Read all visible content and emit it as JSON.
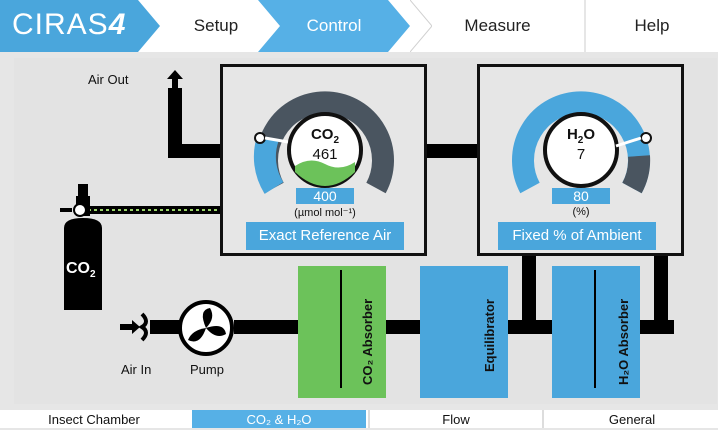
{
  "app": {
    "logo_text": "CIRAS",
    "logo_num": "4"
  },
  "nav": {
    "setup": "Setup",
    "control": "Control",
    "measure": "Measure",
    "help": "Help"
  },
  "co2": {
    "label": "CO",
    "sub": "2",
    "value": "461",
    "setpoint": "400",
    "unit": "(µmol mol⁻¹)",
    "mode": "Exact Reference Air",
    "level_fraction": 0.45
  },
  "h2o": {
    "label": "H",
    "sub_h": "2",
    "label_o": "O",
    "value": "7",
    "setpoint": "80",
    "unit": "(%)",
    "mode": "Fixed % of Ambient",
    "level_fraction": 0.8
  },
  "diagram": {
    "air_out": "Air Out",
    "air_in": "Air In",
    "pump": "Pump",
    "cylinder": "CO",
    "cylinder_sub": "2",
    "co2_absorber": "CO₂ Absorber",
    "equilibrator": "Equilibrator",
    "h2o_absorber": "H₂O Absorber"
  },
  "bottom_tabs": {
    "insect": "Insect Chamber",
    "co2h2o": "CO₂ & H₂O",
    "flow": "Flow",
    "general": "General"
  },
  "colors": {
    "accent": "#4aa6dc",
    "green": "#6cc25a",
    "dark": "#4a5560"
  }
}
